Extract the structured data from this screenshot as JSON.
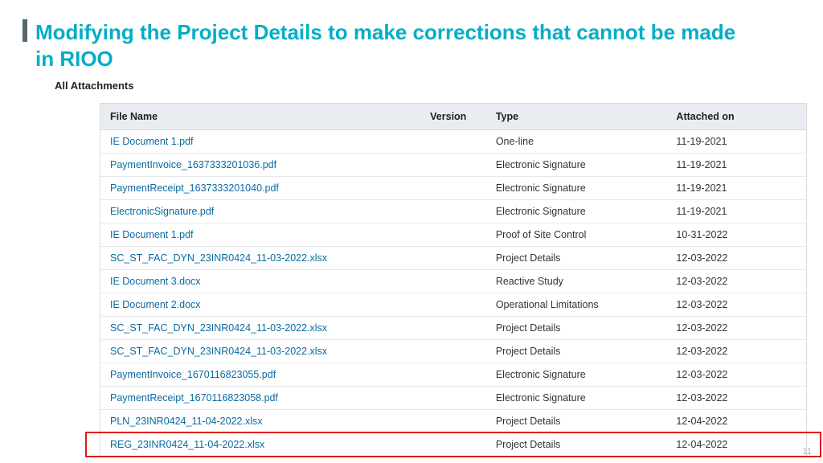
{
  "title": "Modifying the Project Details to make corrections that cannot be made in RIOO",
  "section_label": "All Attachments",
  "headers": {
    "file_name": "File Name",
    "version": "Version",
    "type": "Type",
    "attached_on": "Attached on"
  },
  "rows": [
    {
      "file": "IE Document 1.pdf",
      "version": "",
      "type": "One-line",
      "date": "11-19-2021"
    },
    {
      "file": "PaymentInvoice_1637333201036.pdf",
      "version": "",
      "type": "Electronic Signature",
      "date": "11-19-2021"
    },
    {
      "file": "PaymentReceipt_1637333201040.pdf",
      "version": "",
      "type": "Electronic Signature",
      "date": "11-19-2021"
    },
    {
      "file": "ElectronicSignature.pdf",
      "version": "",
      "type": "Electronic Signature",
      "date": "11-19-2021"
    },
    {
      "file": "IE Document 1.pdf",
      "version": "",
      "type": "Proof of Site Control",
      "date": "10-31-2022"
    },
    {
      "file": "SC_ST_FAC_DYN_23INR0424_11-03-2022.xlsx",
      "version": "",
      "type": "Project Details",
      "date": "12-03-2022"
    },
    {
      "file": "IE Document 3.docx",
      "version": "",
      "type": "Reactive Study",
      "date": "12-03-2022"
    },
    {
      "file": "IE Document 2.docx",
      "version": "",
      "type": "Operational Limitations",
      "date": "12-03-2022"
    },
    {
      "file": "SC_ST_FAC_DYN_23INR0424_11-03-2022.xlsx",
      "version": "",
      "type": "Project Details",
      "date": "12-03-2022"
    },
    {
      "file": "SC_ST_FAC_DYN_23INR0424_11-03-2022.xlsx",
      "version": "",
      "type": "Project Details",
      "date": "12-03-2022"
    },
    {
      "file": "PaymentInvoice_1670116823055.pdf",
      "version": "",
      "type": "Electronic Signature",
      "date": "12-03-2022"
    },
    {
      "file": "PaymentReceipt_1670116823058.pdf",
      "version": "",
      "type": "Electronic Signature",
      "date": "12-03-2022"
    },
    {
      "file": "PLN_23INR0424_11-04-2022.xlsx",
      "version": "",
      "type": "Project Details",
      "date": "12-04-2022"
    },
    {
      "file": "REG_23INR0424_11-04-2022.xlsx",
      "version": "",
      "type": "Project Details",
      "date": "12-04-2022"
    }
  ],
  "page_number": "11"
}
